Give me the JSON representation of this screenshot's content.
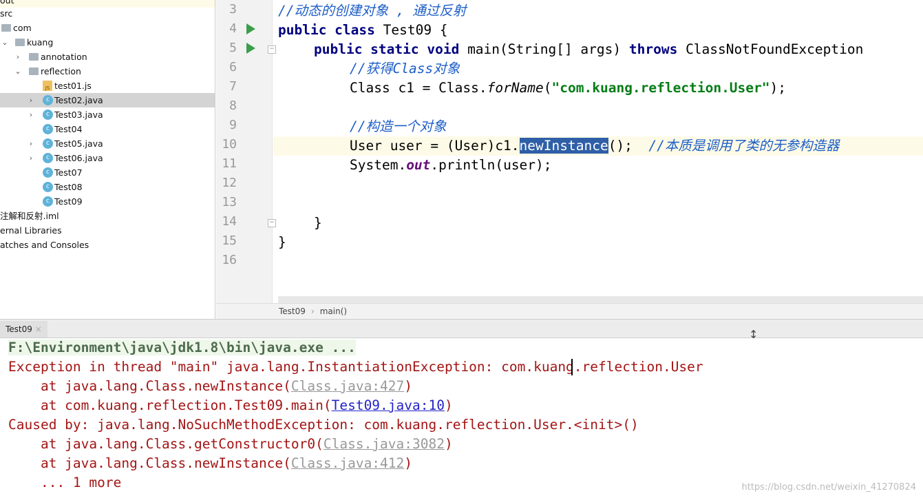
{
  "project_tree": {
    "items": [
      {
        "label": "out",
        "indent": 0
      },
      {
        "label": "src",
        "indent": 0
      },
      {
        "label": "com",
        "indent": 1
      },
      {
        "label": "kuang",
        "indent": 2,
        "expanded": true
      },
      {
        "label": "annotation",
        "indent": 3,
        "expanded": false
      },
      {
        "label": "reflection",
        "indent": 3,
        "expanded": true
      },
      {
        "label": "test01.js",
        "type": "js"
      },
      {
        "label": "Test02.java",
        "type": "class",
        "expandable": true,
        "selected": true
      },
      {
        "label": "Test03.java",
        "type": "class",
        "expandable": true
      },
      {
        "label": "Test04",
        "type": "class"
      },
      {
        "label": "Test05.java",
        "type": "class",
        "expandable": true
      },
      {
        "label": "Test06.java",
        "type": "class",
        "expandable": true
      },
      {
        "label": "Test07",
        "type": "class"
      },
      {
        "label": "Test08",
        "type": "class"
      },
      {
        "label": "Test09",
        "type": "class"
      },
      {
        "label": "注解和反射.iml"
      },
      {
        "label": "ernal Libraries"
      },
      {
        "label": "atches and Consoles"
      }
    ]
  },
  "editor": {
    "line_numbers": [
      "3",
      "4",
      "5",
      "6",
      "7",
      "8",
      "9",
      "10",
      "11",
      "12",
      "13",
      "14",
      "15",
      "16"
    ],
    "current_line": "10",
    "lines": {
      "l3": "//动态的创建对象 , 通过反射",
      "l4_kw": "public class",
      "l4_rest": " Test09 {",
      "l5_kw1": "public static void",
      "l5_mid": " main(String[] args) ",
      "l5_kw2": "throws",
      "l5_rest": " ClassNotFoundException",
      "l6": "//获得Class对象",
      "l7_a": "Class c1 = Class.",
      "l7_m": "forName",
      "l7_b": "(",
      "l7_s": "\"com.kuang.reflection.User\"",
      "l7_c": ");",
      "l9": "//构造一个对象",
      "l10_a": "User user = (User)c1.",
      "l10_sel": "newInstance",
      "l10_b": "();  ",
      "l10_cm": "//本质是调用了类的无参构造器",
      "l11_a": "System.",
      "l11_f": "out",
      "l11_b": ".println(user);",
      "l14": "}",
      "l15": "}"
    },
    "breadcrumb": [
      "Test09",
      "main()"
    ]
  },
  "run_panel": {
    "tab": "Test09",
    "lines": {
      "cmd": "F:\\Environment\\java\\jdk1.8\\bin\\java.exe ...",
      "e1": "Exception in thread \"main\" java.lang.InstantiationException: com.kuang.reflection.User",
      "e2a": "    at java.lang.Class.newInstance(",
      "e2l": "Class.java:427",
      "e2b": ")",
      "e3a": "    at com.kuang.reflection.Test09.main(",
      "e3l": "Test09.java:10",
      "e3b": ")",
      "e4": "Caused by: java.lang.NoSuchMethodException: com.kuang.reflection.User.<init>()",
      "e5a": "    at java.lang.Class.getConstructor0(",
      "e5l": "Class.java:3082",
      "e5b": ")",
      "e6a": "    at java.lang.Class.newInstance(",
      "e6l": "Class.java:412",
      "e6b": ")",
      "e7": "    ... 1 more"
    }
  },
  "watermark": "https://blog.csdn.net/weixin_41270824"
}
